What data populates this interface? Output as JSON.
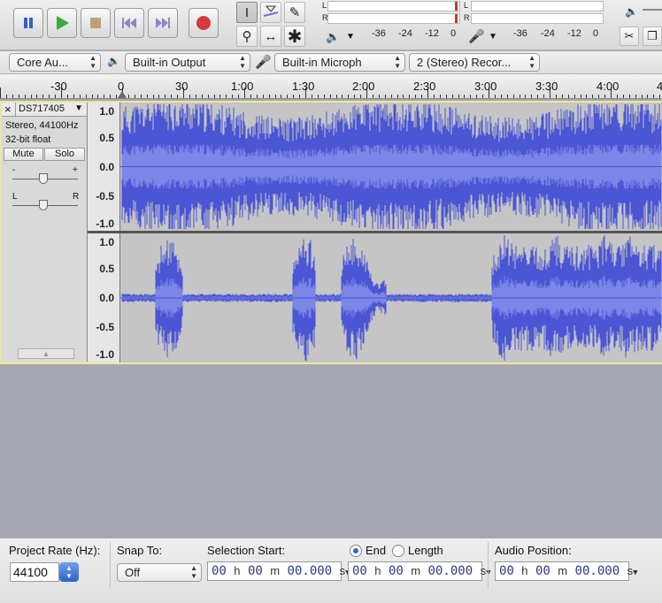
{
  "transport": {
    "pause_icon": "pause-icon",
    "play_icon": "play-icon",
    "stop_icon": "stop-icon",
    "skip_start_icon": "skip-to-start-icon",
    "skip_end_icon": "skip-to-end-icon",
    "record_icon": "record-icon"
  },
  "meters": {
    "playback": {
      "L": "L",
      "R": "R",
      "scale": [
        "-36",
        "-24",
        "-12",
        "0"
      ]
    },
    "record": {
      "L": "L",
      "R": "R",
      "scale": [
        "-36",
        "-24",
        "-12",
        "0"
      ]
    }
  },
  "device": {
    "host": "Core Au...",
    "output": "Built-in Output",
    "input": "Built-in Microph",
    "channels": "2 (Stereo) Recor..."
  },
  "ruler": {
    "labels": [
      "-30",
      "0",
      "30",
      "1:00",
      "1:30",
      "2:00",
      "2:30",
      "3:00",
      "3:30",
      "4:00",
      "4"
    ]
  },
  "track": {
    "name": "DS717405",
    "close": "×",
    "info_rate": "Stereo, 44100Hz",
    "info_format": "32-bit float",
    "mute": "Mute",
    "solo": "Solo",
    "gain_minus": "-",
    "gain_plus": "+",
    "pan_left": "L",
    "pan_right": "R",
    "scale": [
      "1.0",
      "0.5",
      "0.0",
      "-0.5",
      "-1.0"
    ]
  },
  "status": {
    "project_rate_label": "Project Rate (Hz):",
    "project_rate": "44100",
    "snap_label": "Snap To:",
    "snap_value": "Off",
    "sel_start_label": "Selection Start:",
    "end_label": "End",
    "length_label": "Length",
    "audio_pos_label": "Audio Position:",
    "time_h": "00",
    "time_m": "00",
    "time_s": "00.000",
    "unit_h": "h",
    "unit_m": "m",
    "unit_s": "s"
  },
  "colors": {
    "wave": "#4a56d4",
    "wave_rms": "#7b86e6",
    "wave_bg": "#c5c5c5",
    "selection_border": "#e8e8a0"
  }
}
